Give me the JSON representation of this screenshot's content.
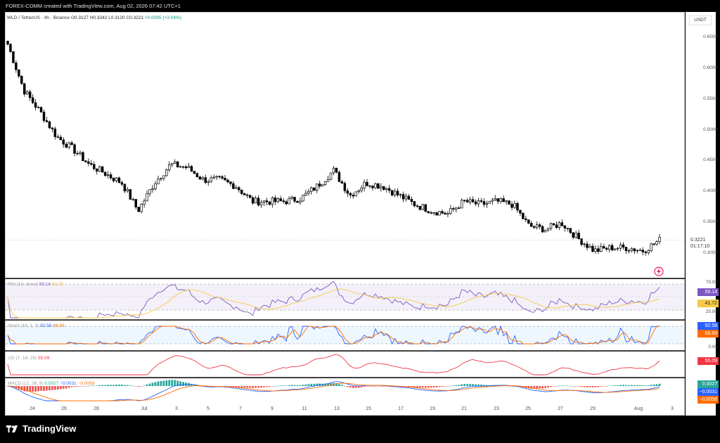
{
  "topbar": {
    "text": "FOREX-COMM created with TradingView.com, Aug 02, 2026 07:42 UTC+1"
  },
  "legend": {
    "symbol": "WLD / TetherUS · 4h · Binance",
    "open_label": "O",
    "open": "0.3127",
    "high_label": "H",
    "high": "0.3242",
    "low_label": "L",
    "low": "0.3120",
    "close_label": "C",
    "close": "0.3221",
    "change": "+0.0095 (+3.04%)"
  },
  "currency_button": "USDT",
  "price_axis": {
    "ticks": [
      "0.6500",
      "0.6000",
      "0.5500",
      "0.5000",
      "0.4500",
      "0.4000",
      "0.3500",
      "0.3000"
    ],
    "current_price": "0.3221",
    "countdown": "01:17:10"
  },
  "rsi": {
    "title": "RSI (14, close)",
    "value": "59.14",
    "ma_value": "41.72",
    "levels": [
      "75.00",
      "25.00"
    ],
    "badge_value": "59.14",
    "badge_ma": "41.72",
    "color_line": "#7e57c2",
    "color_ma": "#f7c948"
  },
  "stoch": {
    "title": "Stoch (14, 1, 3)",
    "k": "92.58",
    "d": "68.89",
    "level_low": "0.00",
    "badge_k": "92.58",
    "badge_d": "68.89",
    "color_k": "#2962ff",
    "color_d": "#ff6d00"
  },
  "uo": {
    "title": "UO (7, 14, 28)",
    "value": "55.09",
    "badge": "55.09",
    "color": "#f23645"
  },
  "macd": {
    "title": "MACD (12, 26, 9)",
    "hist": "0.0027",
    "macd": "−0.0031",
    "signal": "−0.0058",
    "badge_hist": "0.0027",
    "badge_macd": "−0.0031",
    "badge_signal": "−0.0058",
    "color_hist": "#26a69a",
    "color_macd": "#2962ff",
    "color_signal": "#ff6d00"
  },
  "time_axis": [
    "24",
    "26",
    "28",
    "Jul",
    "3",
    "5",
    "7",
    "9",
    "11",
    "13",
    "15",
    "17",
    "19",
    "21",
    "23",
    "25",
    "27",
    "29",
    "Aug",
    "3"
  ],
  "brand": {
    "name": "TradingView"
  },
  "chart_data": {
    "type": "candlestick",
    "interval": "4h",
    "price_range": [
      0.285,
      0.665
    ],
    "close_path_approx": [
      {
        "x": "Jun 23",
        "y": 0.64
      },
      {
        "x": "Jun 24",
        "y": 0.565
      },
      {
        "x": "Jun 25",
        "y": 0.53
      },
      {
        "x": "Jun 26",
        "y": 0.49
      },
      {
        "x": "Jun 27",
        "y": 0.47
      },
      {
        "x": "Jun 28",
        "y": 0.445
      },
      {
        "x": "Jun 29",
        "y": 0.43
      },
      {
        "x": "Jun 30",
        "y": 0.415
      },
      {
        "x": "Jul 1",
        "y": 0.37
      },
      {
        "x": "Jul 2",
        "y": 0.415
      },
      {
        "x": "Jul 3",
        "y": 0.445
      },
      {
        "x": "Jul 4",
        "y": 0.44
      },
      {
        "x": "Jul 5",
        "y": 0.42
      },
      {
        "x": "Jul 6",
        "y": 0.42
      },
      {
        "x": "Jul 7",
        "y": 0.41
      },
      {
        "x": "Jul 8",
        "y": 0.385
      },
      {
        "x": "Jul 9",
        "y": 0.385
      },
      {
        "x": "Jul 10",
        "y": 0.385
      },
      {
        "x": "Jul 11",
        "y": 0.39
      },
      {
        "x": "Jul 12",
        "y": 0.41
      },
      {
        "x": "Jul 13",
        "y": 0.435
      },
      {
        "x": "Jul 14",
        "y": 0.395
      },
      {
        "x": "Jul 15",
        "y": 0.415
      },
      {
        "x": "Jul 16",
        "y": 0.41
      },
      {
        "x": "Jul 17",
        "y": 0.395
      },
      {
        "x": "Jul 18",
        "y": 0.38
      },
      {
        "x": "Jul 19",
        "y": 0.37
      },
      {
        "x": "Jul 20",
        "y": 0.365
      },
      {
        "x": "Jul 21",
        "y": 0.385
      },
      {
        "x": "Jul 22",
        "y": 0.38
      },
      {
        "x": "Jul 23",
        "y": 0.385
      },
      {
        "x": "Jul 24",
        "y": 0.38
      },
      {
        "x": "Jul 25",
        "y": 0.345
      },
      {
        "x": "Jul 26",
        "y": 0.34
      },
      {
        "x": "Jul 27",
        "y": 0.35
      },
      {
        "x": "Jul 28",
        "y": 0.325
      },
      {
        "x": "Jul 29",
        "y": 0.305
      },
      {
        "x": "Jul 30",
        "y": 0.31
      },
      {
        "x": "Jul 31",
        "y": 0.31
      },
      {
        "x": "Aug 1",
        "y": 0.305
      },
      {
        "x": "Aug 2",
        "y": 0.3221
      }
    ]
  }
}
